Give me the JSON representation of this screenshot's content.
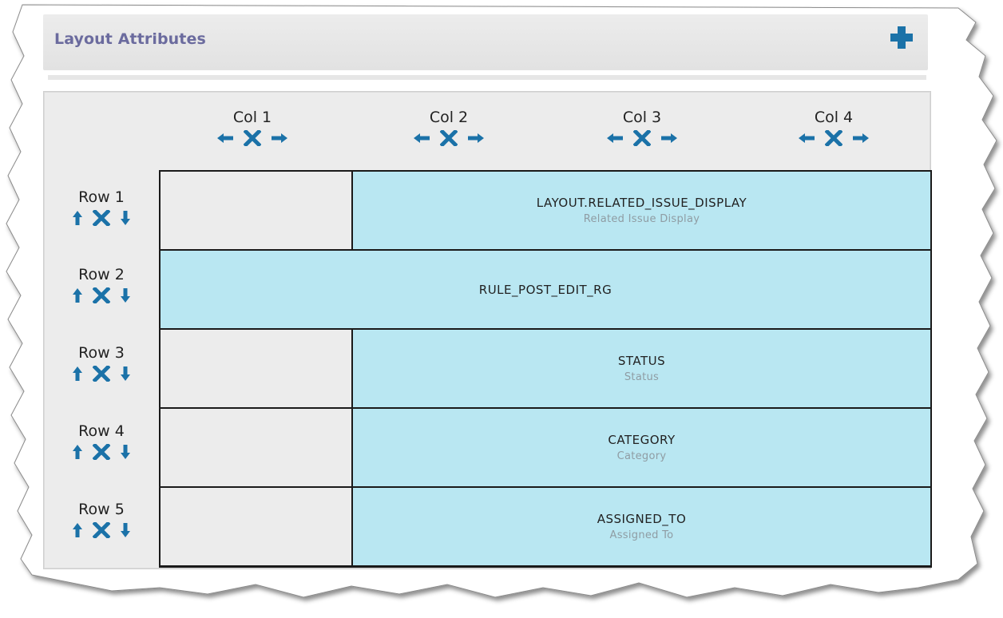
{
  "section": {
    "title": "Layout Attributes",
    "add_icon": "plus-icon"
  },
  "colors": {
    "title": "#6b6b9e",
    "icon_blue": "#1b72a8",
    "field_bg": "#b9e7f2",
    "grid_bg": "#ececec"
  },
  "columns": [
    {
      "label": "Col 1"
    },
    {
      "label": "Col 2"
    },
    {
      "label": "Col 3"
    },
    {
      "label": "Col 4"
    }
  ],
  "rows": [
    {
      "label": "Row 1"
    },
    {
      "label": "Row 2"
    },
    {
      "label": "Row 3"
    },
    {
      "label": "Row 4"
    },
    {
      "label": "Row 5"
    }
  ],
  "fields": [
    {
      "name": "LAYOUT.RELATED_ISSUE_DISPLAY",
      "label": "Related Issue Display"
    },
    {
      "name": "RULE_POST_EDIT_RG",
      "label": ""
    },
    {
      "name": "STATUS",
      "label": "Status"
    },
    {
      "name": "CATEGORY",
      "label": "Category"
    },
    {
      "name": "ASSIGNED_TO",
      "label": "Assigned To"
    }
  ],
  "icons": {
    "col_left": "arrow-left-icon",
    "col_delete": "delete-x-icon",
    "col_right": "arrow-right-icon",
    "row_up": "arrow-up-icon",
    "row_delete": "delete-x-icon",
    "row_down": "arrow-down-icon"
  }
}
